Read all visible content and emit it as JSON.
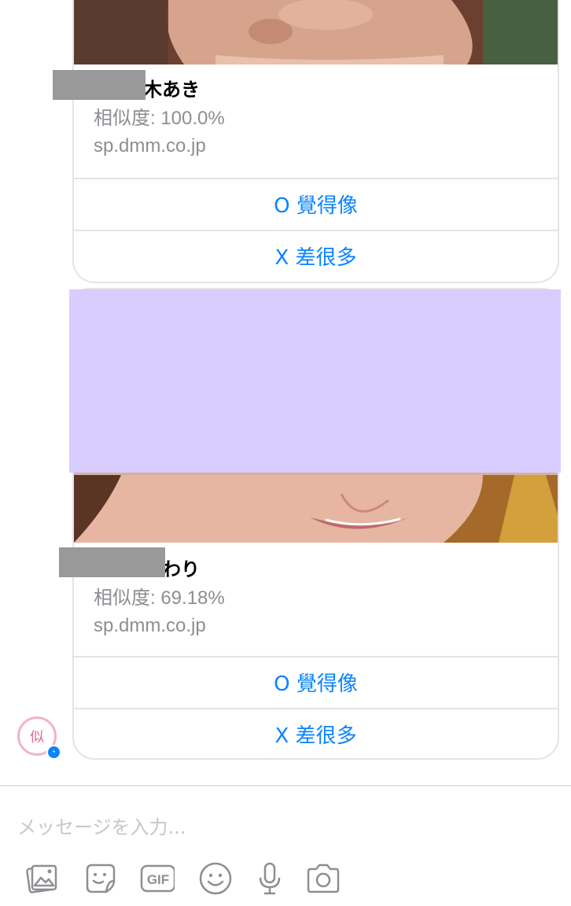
{
  "results": [
    {
      "name_visible": "木あき",
      "similarity": "相似度: 100.0%",
      "domain": "sp.dmm.co.jp",
      "button_yes": "O 覺得像",
      "button_no": "X 差很多"
    },
    {
      "name_visible": "まわり",
      "similarity": "相似度: 69.18%",
      "domain": "sp.dmm.co.jp",
      "button_yes": "O 覺得像",
      "button_no": "X 差很多"
    }
  ],
  "bot_avatar": {
    "glyph": "似"
  },
  "composer": {
    "placeholder": "メッセージを入力...",
    "icons": [
      "photo-icon",
      "sticker-icon",
      "gif-icon",
      "emoji-icon",
      "microphone-icon",
      "camera-icon"
    ],
    "gif_label": "GIF"
  },
  "colors": {
    "accent": "#0a84ff",
    "secondary_text": "#8e8e93",
    "border": "#e4e4e6",
    "redaction_gray": "#999999",
    "redaction_purple": "#d9ccfe"
  }
}
